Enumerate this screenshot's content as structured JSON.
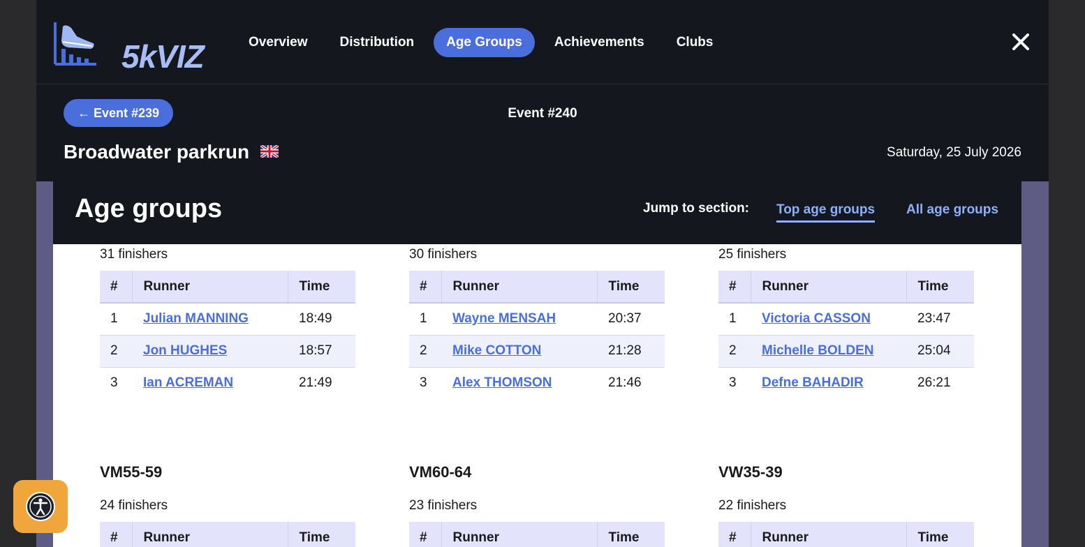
{
  "brand": {
    "name": "5kVIZ"
  },
  "nav": {
    "links": [
      {
        "label": "Overview",
        "active": false
      },
      {
        "label": "Distribution",
        "active": false
      },
      {
        "label": "Age Groups",
        "active": true
      },
      {
        "label": "Achievements",
        "active": false
      },
      {
        "label": "Clubs",
        "active": false
      }
    ]
  },
  "event": {
    "prev_label": "← Event #239",
    "current_label": "Event #240",
    "name": "Broadwater parkrun",
    "date": "Saturday, 25 July 2026"
  },
  "section": {
    "title": "Age groups",
    "jump_label": "Jump to section:",
    "jump_links": [
      {
        "label": "Top age groups",
        "active": true
      },
      {
        "label": "All age groups",
        "active": false
      }
    ]
  },
  "table_headers": {
    "rank": "#",
    "runner": "Runner",
    "time": "Time"
  },
  "groups_top": [
    {
      "finishers": "31 finishers",
      "rows": [
        {
          "rank": "1",
          "runner": "Julian MANNING",
          "time": "18:49"
        },
        {
          "rank": "2",
          "runner": "Jon HUGHES",
          "time": "18:57"
        },
        {
          "rank": "3",
          "runner": "Ian ACREMAN",
          "time": "21:49"
        }
      ]
    },
    {
      "finishers": "30 finishers",
      "rows": [
        {
          "rank": "1",
          "runner": "Wayne MENSAH",
          "time": "20:37"
        },
        {
          "rank": "2",
          "runner": "Mike COTTON",
          "time": "21:28"
        },
        {
          "rank": "3",
          "runner": "Alex THOMSON",
          "time": "21:46"
        }
      ]
    },
    {
      "finishers": "25 finishers",
      "rows": [
        {
          "rank": "1",
          "runner": "Victoria CASSON",
          "time": "23:47"
        },
        {
          "rank": "2",
          "runner": "Michelle BOLDEN",
          "time": "25:04"
        },
        {
          "rank": "3",
          "runner": "Defne BAHADIR",
          "time": "26:21"
        }
      ]
    }
  ],
  "groups_bottom": [
    {
      "title": "VM55-59",
      "finishers": "24 finishers"
    },
    {
      "title": "VM60-64",
      "finishers": "23 finishers"
    },
    {
      "title": "VW35-39",
      "finishers": "22 finishers"
    }
  ],
  "colors": {
    "accent": "#4a6fdc",
    "dark_bg": "#15171f",
    "link": "#8fb0f5",
    "header_row": "#e3e4fb",
    "widget": "#f0a63a"
  }
}
